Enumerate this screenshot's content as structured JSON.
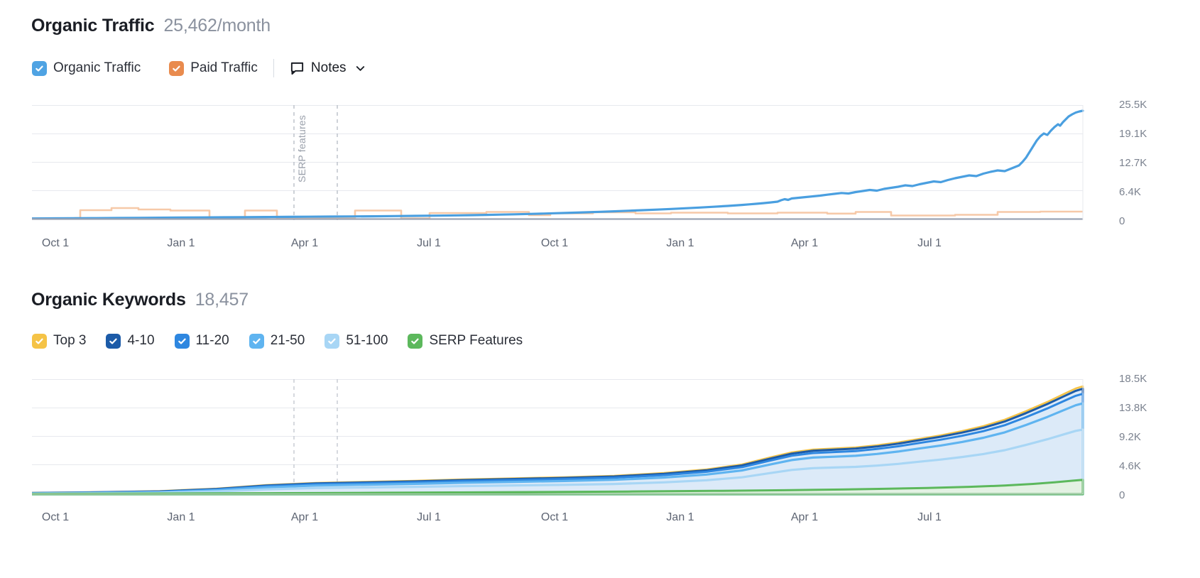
{
  "traffic": {
    "title": "Organic Traffic",
    "value": "25,462/month",
    "legend": [
      {
        "label": "Organic Traffic",
        "color": "#4FA3E3",
        "icon": "checkbox-checked-icon"
      },
      {
        "label": "Paid Traffic",
        "color": "#E98B4E",
        "icon": "checkbox-checked-icon"
      }
    ],
    "notes": {
      "label": "Notes",
      "icon": "note-bubble-icon",
      "chevron": "chevron-down-icon"
    },
    "annotation": "SERP features"
  },
  "keywords": {
    "title": "Organic Keywords",
    "value": "18,457",
    "legend": [
      {
        "label": "Top 3",
        "color": "#F5C346",
        "icon": "checkbox-checked-icon"
      },
      {
        "label": "4-10",
        "color": "#1C5BA8",
        "icon": "checkbox-checked-icon"
      },
      {
        "label": "11-20",
        "color": "#2E87E0",
        "icon": "checkbox-checked-icon"
      },
      {
        "label": "21-50",
        "color": "#5FB4F0",
        "icon": "checkbox-checked-icon"
      },
      {
        "label": "51-100",
        "color": "#A8D6F5",
        "icon": "checkbox-checked-icon"
      },
      {
        "label": "SERP Features",
        "color": "#5CB85C",
        "icon": "checkbox-checked-icon"
      }
    ]
  },
  "chart_data": [
    {
      "type": "line",
      "title": "Organic Traffic",
      "subtitle": "25,462/month",
      "xlabel": "",
      "ylabel": "",
      "ylim": [
        0,
        25500
      ],
      "yticks": [
        0,
        6400,
        12700,
        19100,
        25500
      ],
      "ytick_labels": [
        "0",
        "6.4K",
        "12.7K",
        "19.1K",
        "25.5K"
      ],
      "xtick_labels": [
        "Oct 1",
        "Jan 1",
        "Apr 1",
        "Jul 1",
        "Oct 1",
        "Jan 1",
        "Apr 1",
        "Jul 1"
      ],
      "grid": true,
      "legend_position": "top-left",
      "annotations": [
        {
          "text": "SERP features",
          "orientation": "vertical",
          "x_index": 2
        }
      ],
      "series": [
        {
          "name": "Organic Traffic",
          "color": "#4A9FE0",
          "values": [
            120,
            130,
            140,
            150,
            160,
            175,
            185,
            195,
            205,
            215,
            225,
            240,
            250,
            260,
            270,
            280,
            290,
            300,
            310,
            315,
            320,
            330,
            340,
            345,
            350,
            360,
            365,
            370,
            380,
            390,
            400,
            410,
            420,
            430,
            445,
            460,
            470,
            490,
            510,
            530,
            550,
            575,
            600,
            630,
            660,
            700,
            740,
            780,
            820,
            870,
            920,
            980,
            1040,
            1100,
            1160,
            1230,
            1300,
            1380,
            1460,
            1540,
            1620,
            1700,
            1790,
            1880,
            1960,
            2050,
            2150,
            2260,
            2380,
            2500,
            2640,
            2780,
            2930,
            3080,
            3250,
            3420,
            3600,
            3780,
            3980,
            4180,
            4400,
            4620,
            4880,
            5150,
            5420,
            5700,
            6000,
            6350,
            6700,
            7050,
            7400,
            7800,
            8200,
            8600,
            9100,
            9600,
            10200,
            10900,
            11700,
            12600,
            13600,
            14700,
            15900,
            17200,
            18600,
            20100,
            21500,
            22700,
            23600,
            24300,
            24800,
            25200,
            25462
          ]
        },
        {
          "name": "Paid Traffic",
          "color": "#F6C9A8",
          "values": [
            40,
            40,
            40,
            40,
            45,
            180,
            180,
            180,
            180,
            220,
            220,
            220,
            220,
            220,
            200,
            200,
            200,
            200,
            200,
            200,
            195,
            195,
            195,
            195,
            160,
            160,
            160,
            160,
            160,
            160,
            160,
            160,
            160,
            160,
            160,
            160,
            170,
            170,
            170,
            170,
            40,
            40,
            40,
            40,
            40,
            170,
            170,
            170,
            170,
            170,
            40,
            40,
            40,
            40,
            40,
            40,
            40,
            230,
            230,
            230,
            230,
            230,
            230,
            210,
            210,
            210,
            210,
            150,
            150,
            150,
            150,
            180,
            180,
            180,
            180,
            180,
            210,
            210,
            210,
            210,
            210,
            210,
            210,
            210,
            210,
            210,
            210,
            210,
            210,
            210,
            210,
            210,
            210,
            210,
            210,
            210,
            210,
            210,
            210,
            210,
            210,
            210,
            240,
            240,
            240,
            240,
            240,
            240,
            240,
            240,
            240,
            240,
            240
          ]
        }
      ]
    },
    {
      "type": "area",
      "title": "Organic Keywords",
      "subtitle": "18,457",
      "stacked": true,
      "xlabel": "",
      "ylabel": "",
      "ylim": [
        0,
        18500
      ],
      "yticks": [
        0,
        4600,
        9200,
        13800,
        18500
      ],
      "ytick_labels": [
        "0",
        "4.6K",
        "9.2K",
        "13.8K",
        "18.5K"
      ],
      "xtick_labels": [
        "Oct 1",
        "Jan 1",
        "Apr 1",
        "Jul 1",
        "Oct 1",
        "Jan 1",
        "Apr 1",
        "Jul 1"
      ],
      "grid": true,
      "legend_position": "top-left",
      "series": [
        {
          "name": "SERP Features",
          "color": "#5CB85C",
          "values": [
            60,
            62,
            64,
            66,
            68,
            70,
            72,
            74,
            76,
            78,
            80,
            82,
            85,
            88,
            90,
            92,
            95,
            98,
            100,
            103,
            106,
            110,
            113,
            116,
            120,
            124,
            128,
            132,
            136,
            140,
            145,
            150,
            155,
            160,
            165,
            170,
            176,
            182,
            188,
            194,
            200,
            207,
            214,
            221,
            228,
            236,
            244,
            252,
            260,
            270,
            280,
            290,
            300,
            310,
            322,
            334,
            346,
            358,
            370,
            384,
            398,
            412,
            426,
            442,
            458,
            474,
            490,
            508,
            526,
            544,
            564,
            584,
            604,
            626,
            648,
            672,
            696,
            720,
            746,
            772,
            800,
            828,
            858,
            888,
            920,
            952,
            986,
            1020,
            1056,
            1092,
            1130,
            1168,
            1208,
            1248,
            1290,
            1332,
            1376,
            1420,
            1466,
            1512,
            1560,
            1608,
            1658,
            1708,
            1760,
            1812,
            1866,
            1920,
            1976,
            2032,
            2090,
            2150
          ]
        },
        {
          "name": "51-100",
          "color": "#D3E9F9",
          "values": [
            30,
            32,
            34,
            36,
            40,
            45,
            52,
            60,
            70,
            82,
            95,
            110,
            130,
            155,
            185,
            220,
            260,
            300,
            345,
            390,
            435,
            480,
            520,
            560,
            600,
            640,
            680,
            715,
            750,
            785,
            820,
            855,
            890,
            925,
            960,
            995,
            1030,
            1065,
            1100,
            1140,
            1180,
            1220,
            1260,
            1300,
            1340,
            1385,
            1430,
            1475,
            1520,
            1565,
            1610,
            1660,
            1710,
            1760,
            1810,
            1860,
            1915,
            1970,
            2025,
            2080,
            2140,
            2200,
            2260,
            2320,
            2385,
            2450,
            2520,
            2590,
            2665,
            2740,
            2820,
            2900,
            2985,
            3070,
            3160,
            3250,
            3345,
            3440,
            3540,
            3640,
            3745,
            3850,
            3960,
            4070,
            4185,
            4300,
            4420,
            4540,
            4665,
            4790,
            4920,
            5050,
            5185,
            5320,
            5460,
            5600,
            5745,
            5890,
            6040,
            6190,
            6345,
            6500,
            6660,
            6820,
            6985,
            7150,
            7320,
            7490,
            7665,
            7840,
            8020,
            8200,
            8400
          ]
        },
        {
          "name": "21-50",
          "color": "#5FB4F0",
          "values": [
            20,
            21,
            22,
            24,
            27,
            31,
            36,
            42,
            50,
            60,
            72,
            86,
            102,
            120,
            142,
            166,
            192,
            220,
            248,
            276,
            304,
            332,
            358,
            384,
            410,
            436,
            462,
            486,
            510,
            534,
            558,
            582,
            606,
            630,
            654,
            678,
            702,
            726,
            750,
            776,
            802,
            828,
            854,
            880,
            906,
            934,
            962,
            990,
            1018,
            1046,
            1074,
            1104,
            1134,
            1164,
            1194,
            1224,
            1256,
            1288,
            1320,
            1352,
            1386,
            1420,
            1454,
            1488,
            1524,
            1560,
            1598,
            1636,
            1676,
            1716,
            1758,
            1800,
            1844,
            1888,
            1934,
            1980,
            2028,
            2076,
            2126,
            2176,
            2228,
            2280,
            2334,
            2388,
            2444,
            2500,
            2558,
            2616,
            2676,
            2736,
            2798,
            2860,
            2924,
            2988,
            3054,
            3120,
            3188,
            3256,
            3326,
            3396,
            3468,
            3540,
            3614,
            3688,
            3764,
            3840,
            3918,
            3996,
            4076,
            4156,
            4238,
            4320,
            4410
          ]
        },
        {
          "name": "11-20",
          "color": "#2E87E0",
          "values": [
            10,
            11,
            12,
            13,
            15,
            17,
            20,
            24,
            29,
            35,
            42,
            50,
            60,
            71,
            84,
            98,
            113,
            129,
            146,
            163,
            180,
            197,
            213,
            229,
            245,
            261,
            277,
            292,
            307,
            322,
            337,
            352,
            367,
            382,
            397,
            412,
            427,
            442,
            457,
            473,
            489,
            505,
            521,
            537,
            553,
            570,
            587,
            604,
            621,
            638,
            655,
            673,
            691,
            709,
            727,
            745,
            764,
            783,
            802,
            821,
            841,
            861,
            881,
            901,
            922,
            943,
            965,
            987,
            1010,
            1033,
            1057,
            1081,
            1106,
            1131,
            1157,
            1183,
            1210,
            1237,
            1265,
            1293,
            1322,
            1351,
            1381,
            1411,
            1442,
            1473,
            1505,
            1537,
            1570,
            1603,
            1637,
            1671,
            1706,
            1741,
            1777,
            1813,
            1850,
            1887,
            1925,
            1963,
            2002,
            2041,
            2081,
            2121,
            2162,
            2203,
            2245,
            2287,
            2330,
            2373,
            2417,
            2461,
            2506,
            2560
          ]
        },
        {
          "name": "4-10",
          "color": "#1C5BA8",
          "values": [
            8,
            8,
            9,
            10,
            11,
            13,
            15,
            18,
            22,
            26,
            31,
            37,
            44,
            52,
            61,
            71,
            82,
            93,
            105,
            117,
            129,
            141,
            153,
            165,
            177,
            189,
            201,
            212,
            223,
            234,
            245,
            256,
            267,
            278,
            289,
            300,
            311,
            322,
            333,
            344,
            355,
            366,
            377,
            388,
            399,
            411,
            423,
            435,
            447,
            459,
            471,
            484,
            497,
            510,
            523,
            536,
            549,
            562,
            575,
            589,
            603,
            617,
            631,
            645,
            660,
            675,
            690,
            705,
            721,
            737,
            753,
            769,
            786,
            803,
            820,
            838,
            856,
            874,
            892,
            911,
            930,
            949,
            969,
            989,
            1009,
            1030,
            1051,
            1072,
            1094,
            1116,
            1138,
            1161,
            1184,
            1207,
            1231,
            1255,
            1279,
            1304,
            1329,
            1354,
            1380,
            1406,
            1432,
            1459,
            1486,
            1513,
            1541,
            1569,
            1597,
            1626,
            1655,
            1684,
            1714,
            1750
          ]
        },
        {
          "name": "Top 3",
          "color": "#F5C346",
          "values": [
            4,
            4,
            5,
            5,
            6,
            7,
            8,
            9,
            11,
            13,
            16,
            19,
            22,
            26,
            31,
            36,
            41,
            47,
            53,
            59,
            65,
            71,
            77,
            83,
            89,
            95,
            101,
            107,
            112,
            118,
            123,
            129,
            134,
            140,
            145,
            151,
            156,
            162,
            167,
            173,
            178,
            184,
            189,
            195,
            201,
            207,
            213,
            219,
            225,
            231,
            237,
            243,
            250,
            256,
            263,
            269,
            276,
            283,
            289,
            296,
            303,
            310,
            317,
            324,
            331,
            339,
            346,
            354,
            362,
            370,
            378,
            386,
            394,
            403,
            411,
            420,
            429,
            438,
            447,
            456,
            466,
            475,
            485,
            495,
            505,
            515,
            525,
            536,
            547,
            558,
            569,
            580,
            592,
            604,
            616,
            628,
            640,
            653,
            666,
            679,
            692,
            705,
            719,
            733,
            747,
            761,
            776,
            791,
            806,
            821,
            837,
            853,
            869,
            886,
            903
          ]
        }
      ]
    }
  ]
}
